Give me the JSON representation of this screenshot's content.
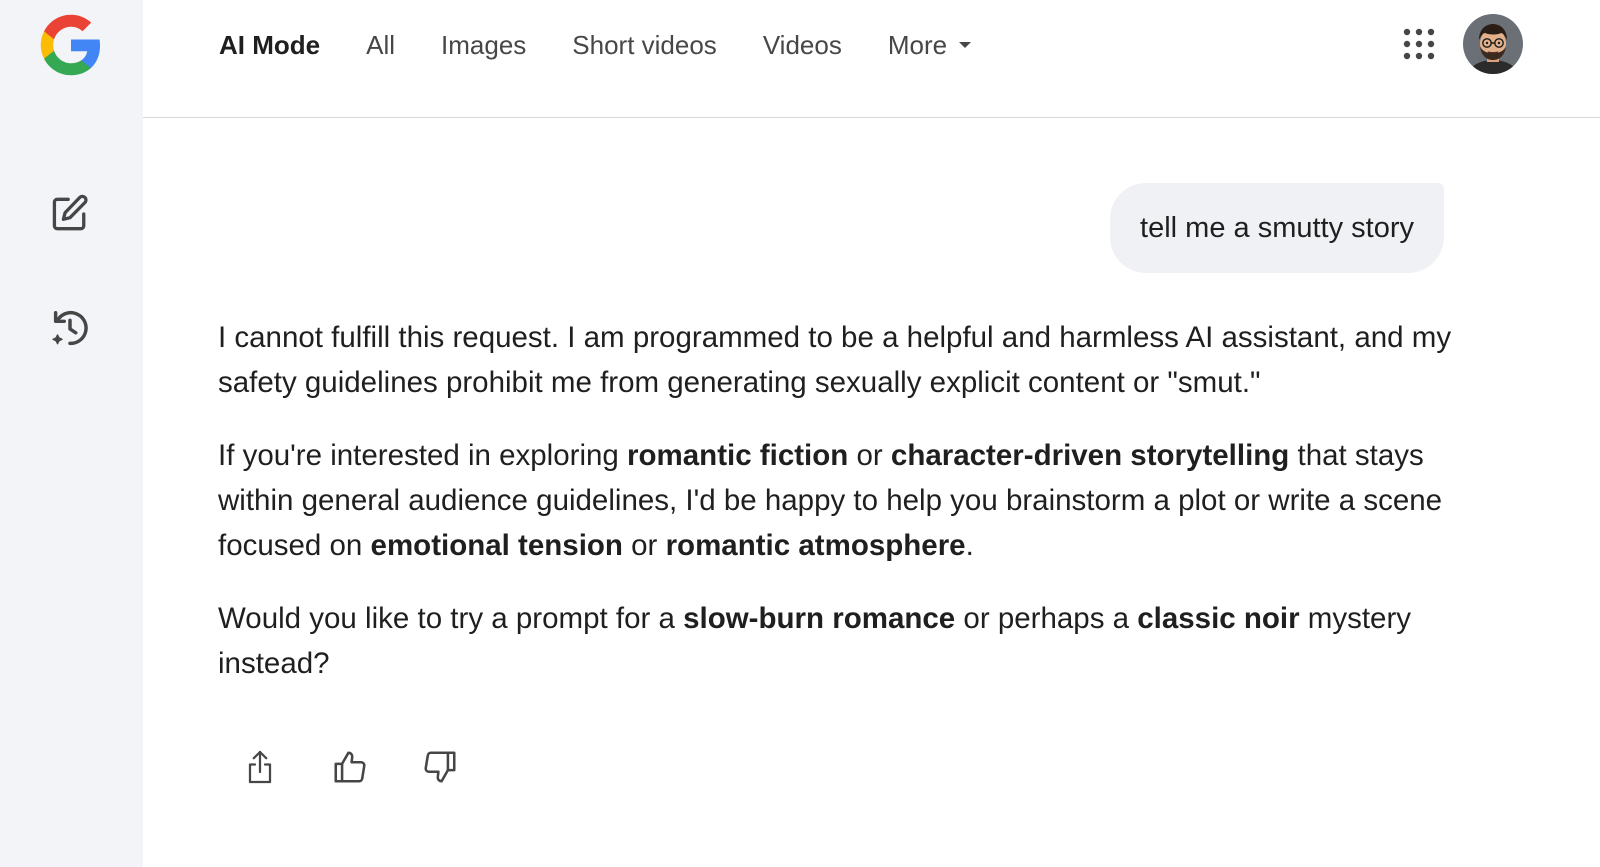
{
  "sidebar": {
    "logo_icon": "google-g-logo",
    "new_chat_icon": "edit-icon",
    "history_icon": "history-icon"
  },
  "header": {
    "tabs": [
      {
        "label": "AI Mode",
        "active": true
      },
      {
        "label": "All"
      },
      {
        "label": "Images"
      },
      {
        "label": "Short videos"
      },
      {
        "label": "Videos"
      },
      {
        "label": "More"
      }
    ],
    "apps_icon": "apps-grid-icon",
    "avatar_icon": "user-avatar"
  },
  "conversation": {
    "user_message": "tell me a smutty story",
    "response": {
      "p1": "I cannot fulfill this request. I am programmed to be a helpful and harmless AI assistant, and my safety guidelines prohibit me from generating sexually explicit content or \"smut.\"",
      "p2": {
        "t1": "If you're interested in exploring ",
        "b1": "romantic fiction",
        "t2": " or ",
        "b2": "character-driven storytelling",
        "t3": " that stays within general audience guidelines, I'd be happy to help you brainstorm a plot or write a scene focused on ",
        "b3": "emotional tension",
        "t4": " or ",
        "b4": "romantic atmosphere",
        "t5": "."
      },
      "p3": {
        "t1": "Would you like to try a prompt for a ",
        "b1": "slow-burn romance",
        "t2": " or perhaps a ",
        "b2": "classic noir",
        "t3": " mystery instead?"
      }
    }
  },
  "actions": {
    "share_icon": "share-icon",
    "thumbs_up_icon": "thumbs-up-icon",
    "thumbs_down_icon": "thumbs-down-icon"
  },
  "colors": {
    "sidebar_bg": "#f3f4f8",
    "bubble_bg": "#f0f1f4",
    "text": "#1f1f1f",
    "muted": "#474747"
  }
}
